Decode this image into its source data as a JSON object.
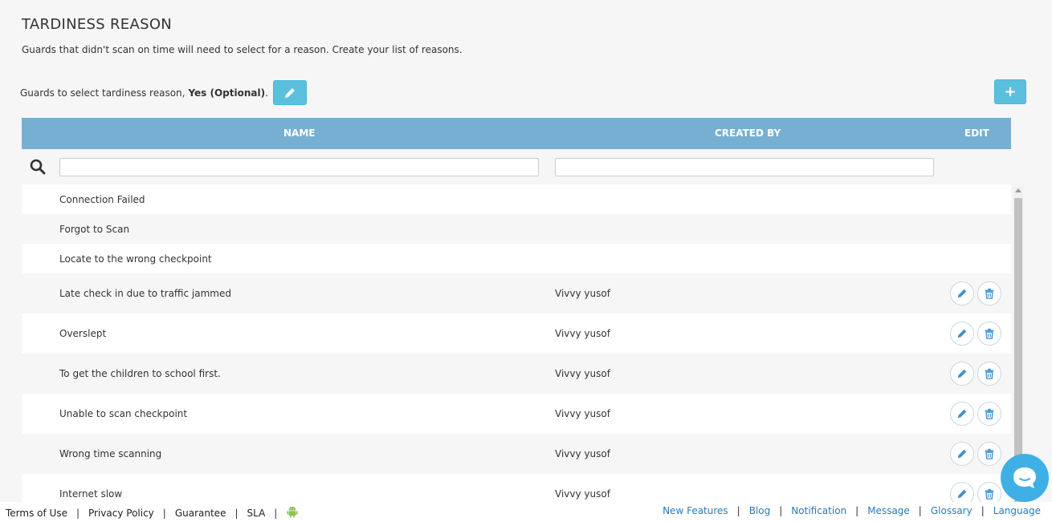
{
  "header": {
    "title": "TARDINESS REASON",
    "subtitle": "Guards that didn't scan on time will need to select for a reason. Create your list of reasons."
  },
  "setting": {
    "label": "Guards to select tardiness reason,",
    "value": "Yes (Optional)",
    "suffix": ".",
    "edit_icon": "pencil-icon"
  },
  "add_button": {
    "label": "+"
  },
  "table": {
    "columns": [
      "NAME",
      "CREATED BY",
      "EDIT"
    ],
    "filters": {
      "name_placeholder": "",
      "created_placeholder": ""
    },
    "rows": [
      {
        "name": "Connection Failed",
        "created_by": "",
        "editable": false
      },
      {
        "name": "Forgot to Scan",
        "created_by": "",
        "editable": false
      },
      {
        "name": "Locate to the wrong checkpoint",
        "created_by": "",
        "editable": false
      },
      {
        "name": "Late check in due to traffic jammed",
        "created_by": "Vivvy yusof",
        "editable": true
      },
      {
        "name": "Overslept",
        "created_by": "Vivvy yusof",
        "editable": true
      },
      {
        "name": "To get the children to school first.",
        "created_by": "Vivvy yusof",
        "editable": true
      },
      {
        "name": "Unable to scan checkpoint",
        "created_by": "Vivvy yusof",
        "editable": true
      },
      {
        "name": "Wrong time scanning",
        "created_by": "Vivvy yusof",
        "editable": true
      },
      {
        "name": "Internet slow",
        "created_by": "Vivvy yusof",
        "editable": true
      }
    ]
  },
  "footer": {
    "left_links": [
      "Terms of Use",
      "Privacy Policy",
      "Guarantee",
      "SLA"
    ],
    "right_links": [
      "New Features",
      "Blog",
      "Notification",
      "Message",
      "Glossary",
      "Language"
    ],
    "separator": "|"
  },
  "colors": {
    "header_bg": "#77afd3",
    "button_bg": "#5bc0de",
    "link": "#2a7ab8",
    "icon_blue": "#3a8fd0",
    "android_green": "#8bc34a",
    "chat_bg": "#3fb0e6"
  }
}
